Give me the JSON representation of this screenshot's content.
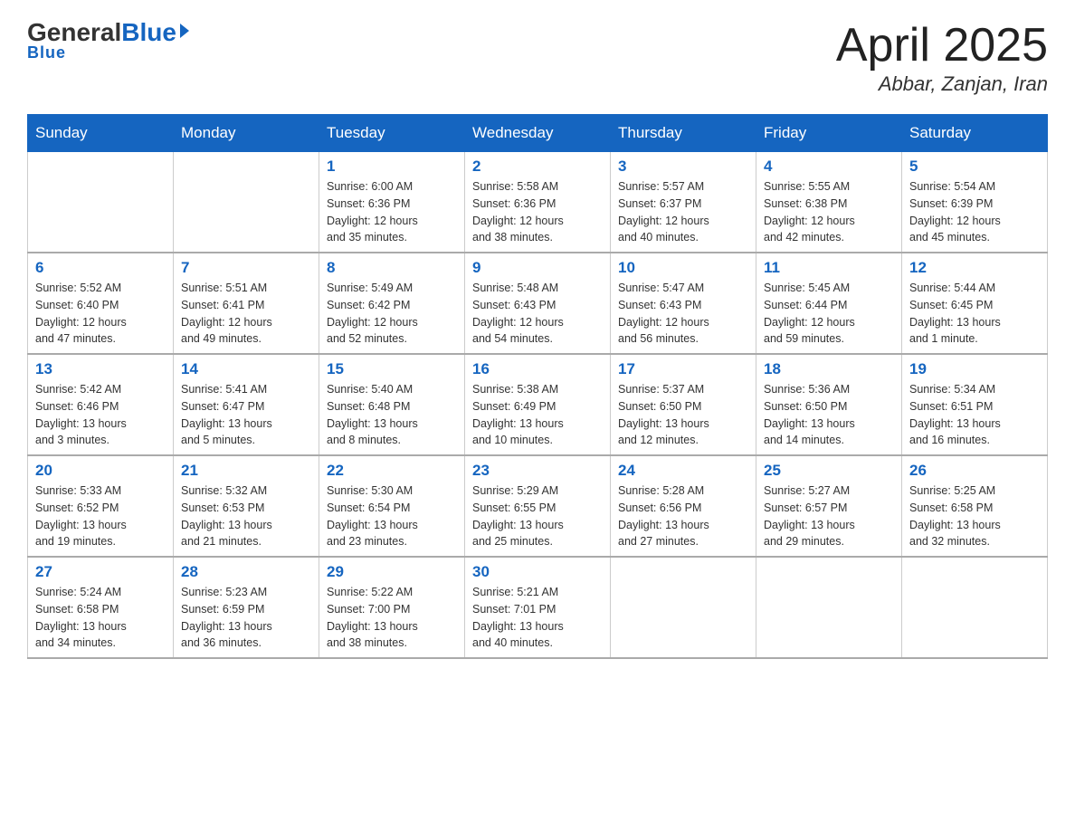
{
  "header": {
    "logo_general": "General",
    "logo_blue": "Blue",
    "month_title": "April 2025",
    "location": "Abbar, Zanjan, Iran"
  },
  "days_of_week": [
    "Sunday",
    "Monday",
    "Tuesday",
    "Wednesday",
    "Thursday",
    "Friday",
    "Saturday"
  ],
  "weeks": [
    [
      {
        "day": "",
        "info": ""
      },
      {
        "day": "",
        "info": ""
      },
      {
        "day": "1",
        "info": "Sunrise: 6:00 AM\nSunset: 6:36 PM\nDaylight: 12 hours\nand 35 minutes."
      },
      {
        "day": "2",
        "info": "Sunrise: 5:58 AM\nSunset: 6:36 PM\nDaylight: 12 hours\nand 38 minutes."
      },
      {
        "day": "3",
        "info": "Sunrise: 5:57 AM\nSunset: 6:37 PM\nDaylight: 12 hours\nand 40 minutes."
      },
      {
        "day": "4",
        "info": "Sunrise: 5:55 AM\nSunset: 6:38 PM\nDaylight: 12 hours\nand 42 minutes."
      },
      {
        "day": "5",
        "info": "Sunrise: 5:54 AM\nSunset: 6:39 PM\nDaylight: 12 hours\nand 45 minutes."
      }
    ],
    [
      {
        "day": "6",
        "info": "Sunrise: 5:52 AM\nSunset: 6:40 PM\nDaylight: 12 hours\nand 47 minutes."
      },
      {
        "day": "7",
        "info": "Sunrise: 5:51 AM\nSunset: 6:41 PM\nDaylight: 12 hours\nand 49 minutes."
      },
      {
        "day": "8",
        "info": "Sunrise: 5:49 AM\nSunset: 6:42 PM\nDaylight: 12 hours\nand 52 minutes."
      },
      {
        "day": "9",
        "info": "Sunrise: 5:48 AM\nSunset: 6:43 PM\nDaylight: 12 hours\nand 54 minutes."
      },
      {
        "day": "10",
        "info": "Sunrise: 5:47 AM\nSunset: 6:43 PM\nDaylight: 12 hours\nand 56 minutes."
      },
      {
        "day": "11",
        "info": "Sunrise: 5:45 AM\nSunset: 6:44 PM\nDaylight: 12 hours\nand 59 minutes."
      },
      {
        "day": "12",
        "info": "Sunrise: 5:44 AM\nSunset: 6:45 PM\nDaylight: 13 hours\nand 1 minute."
      }
    ],
    [
      {
        "day": "13",
        "info": "Sunrise: 5:42 AM\nSunset: 6:46 PM\nDaylight: 13 hours\nand 3 minutes."
      },
      {
        "day": "14",
        "info": "Sunrise: 5:41 AM\nSunset: 6:47 PM\nDaylight: 13 hours\nand 5 minutes."
      },
      {
        "day": "15",
        "info": "Sunrise: 5:40 AM\nSunset: 6:48 PM\nDaylight: 13 hours\nand 8 minutes."
      },
      {
        "day": "16",
        "info": "Sunrise: 5:38 AM\nSunset: 6:49 PM\nDaylight: 13 hours\nand 10 minutes."
      },
      {
        "day": "17",
        "info": "Sunrise: 5:37 AM\nSunset: 6:50 PM\nDaylight: 13 hours\nand 12 minutes."
      },
      {
        "day": "18",
        "info": "Sunrise: 5:36 AM\nSunset: 6:50 PM\nDaylight: 13 hours\nand 14 minutes."
      },
      {
        "day": "19",
        "info": "Sunrise: 5:34 AM\nSunset: 6:51 PM\nDaylight: 13 hours\nand 16 minutes."
      }
    ],
    [
      {
        "day": "20",
        "info": "Sunrise: 5:33 AM\nSunset: 6:52 PM\nDaylight: 13 hours\nand 19 minutes."
      },
      {
        "day": "21",
        "info": "Sunrise: 5:32 AM\nSunset: 6:53 PM\nDaylight: 13 hours\nand 21 minutes."
      },
      {
        "day": "22",
        "info": "Sunrise: 5:30 AM\nSunset: 6:54 PM\nDaylight: 13 hours\nand 23 minutes."
      },
      {
        "day": "23",
        "info": "Sunrise: 5:29 AM\nSunset: 6:55 PM\nDaylight: 13 hours\nand 25 minutes."
      },
      {
        "day": "24",
        "info": "Sunrise: 5:28 AM\nSunset: 6:56 PM\nDaylight: 13 hours\nand 27 minutes."
      },
      {
        "day": "25",
        "info": "Sunrise: 5:27 AM\nSunset: 6:57 PM\nDaylight: 13 hours\nand 29 minutes."
      },
      {
        "day": "26",
        "info": "Sunrise: 5:25 AM\nSunset: 6:58 PM\nDaylight: 13 hours\nand 32 minutes."
      }
    ],
    [
      {
        "day": "27",
        "info": "Sunrise: 5:24 AM\nSunset: 6:58 PM\nDaylight: 13 hours\nand 34 minutes."
      },
      {
        "day": "28",
        "info": "Sunrise: 5:23 AM\nSunset: 6:59 PM\nDaylight: 13 hours\nand 36 minutes."
      },
      {
        "day": "29",
        "info": "Sunrise: 5:22 AM\nSunset: 7:00 PM\nDaylight: 13 hours\nand 38 minutes."
      },
      {
        "day": "30",
        "info": "Sunrise: 5:21 AM\nSunset: 7:01 PM\nDaylight: 13 hours\nand 40 minutes."
      },
      {
        "day": "",
        "info": ""
      },
      {
        "day": "",
        "info": ""
      },
      {
        "day": "",
        "info": ""
      }
    ]
  ]
}
